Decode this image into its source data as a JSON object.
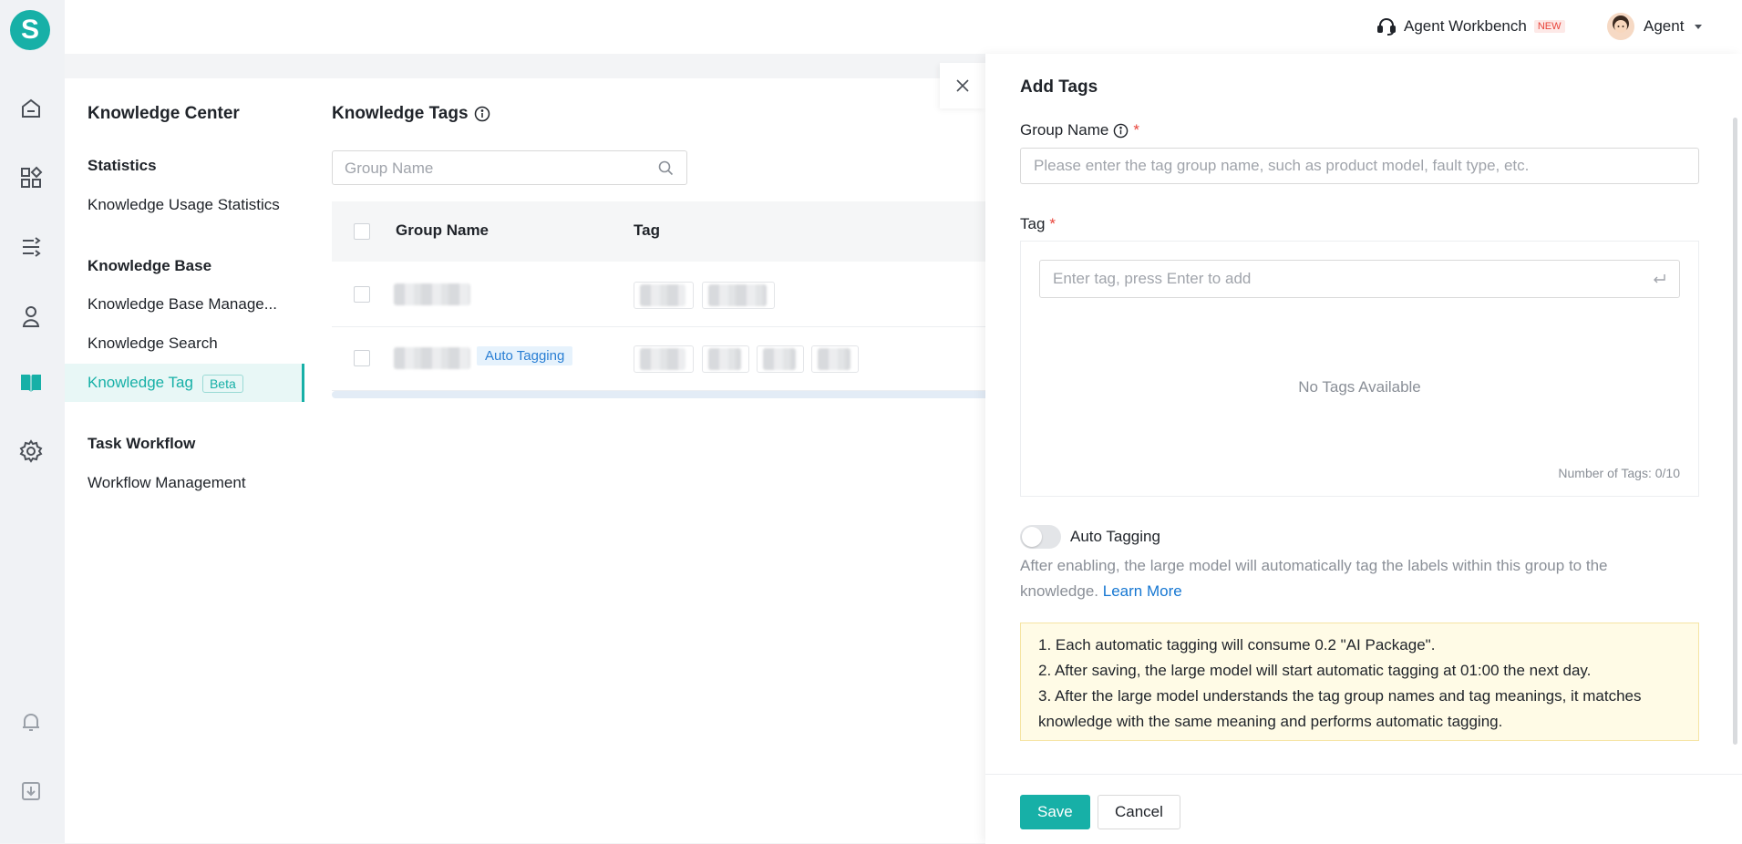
{
  "app": {
    "logo_letter": "S"
  },
  "nav": {
    "icons": [
      "home-icon",
      "apps-icon",
      "workflow-icon",
      "user-icon",
      "knowledge-book-icon",
      "settings-icon",
      "bell-icon",
      "download-icon"
    ],
    "active_color": "#17b0a7"
  },
  "topbar": {
    "workbench_label": "Agent Workbench",
    "new_badge": "NEW",
    "user_name": "Agent"
  },
  "sidebar": {
    "title": "Knowledge Center",
    "sections": [
      {
        "title": "Statistics",
        "items": [
          "Knowledge Usage Statistics"
        ]
      },
      {
        "title": "Knowledge Base",
        "items": [
          "Knowledge Base Manage...",
          "Knowledge Search",
          "Knowledge Tag"
        ]
      },
      {
        "title": "Task Workflow",
        "items": [
          "Workflow Management"
        ]
      }
    ],
    "active_item": "Knowledge Tag",
    "beta_badge": "Beta"
  },
  "main": {
    "title": "Knowledge Tags",
    "search_placeholder": "Group Name",
    "columns": [
      "Group Name",
      "Tag"
    ],
    "rows": [
      {
        "group_name": "",
        "auto_tagging_chip": "",
        "tags": [
          "",
          ""
        ]
      },
      {
        "group_name": "",
        "auto_tagging_chip": "Auto Tagging",
        "tags": [
          "",
          "",
          "",
          ""
        ]
      }
    ]
  },
  "drawer": {
    "title": "Add Tags",
    "group_name_label": "Group Name",
    "group_name_placeholder": "Please enter the tag group name, such as product model, fault type, etc.",
    "tag_label": "Tag",
    "tag_placeholder": "Enter tag, press Enter to add",
    "empty_text": "No Tags Available",
    "tag_count": "Number of Tags: 0/10",
    "auto_tagging_label": "Auto Tagging",
    "auto_tagging_enabled": false,
    "auto_tagging_desc": "After enabling, the large model will automatically tag the labels within this group to the knowledge.",
    "learn_more": "Learn More",
    "notices": [
      "1. Each automatic tagging will consume 0.2 \"AI Package\".",
      "2. After saving, the large model will start automatic tagging at 01:00 the next day.",
      "3. After the large model understands the tag group names and tag meanings, it matches knowledge with the same meaning and performs automatic tagging."
    ],
    "save_label": "Save",
    "cancel_label": "Cancel"
  }
}
